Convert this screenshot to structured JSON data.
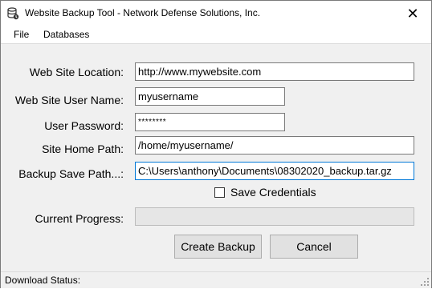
{
  "window": {
    "title": "Website Backup Tool - Network Defense Solutions, Inc."
  },
  "menu": {
    "items": [
      "File",
      "Databases"
    ]
  },
  "form": {
    "site_location_label": "Web Site Location:",
    "site_location_value": "http://www.mywebsite.com",
    "user_name_label": "Web Site User Name:",
    "user_name_value": "myusername",
    "password_label": "User Password:",
    "password_value": "********",
    "home_path_label": "Site Home Path:",
    "home_path_value": "/home/myusername/",
    "save_path_label": "Backup Save Path...:",
    "save_path_value": "C:\\Users\\anthony\\Documents\\08302020_backup.tar.gz",
    "save_credentials_label": "Save Credentials",
    "save_credentials_checked": false,
    "progress_label": "Current Progress:",
    "progress_value": 0
  },
  "buttons": {
    "create_label": "Create Backup",
    "cancel_label": "Cancel"
  },
  "status": {
    "text": "Download Status:"
  },
  "icons": {
    "app": "database-icon",
    "close": "close-icon",
    "grip": "resize-grip-icon"
  },
  "colors": {
    "focus_border": "#0078d7",
    "progress_fill": "#06b025"
  }
}
